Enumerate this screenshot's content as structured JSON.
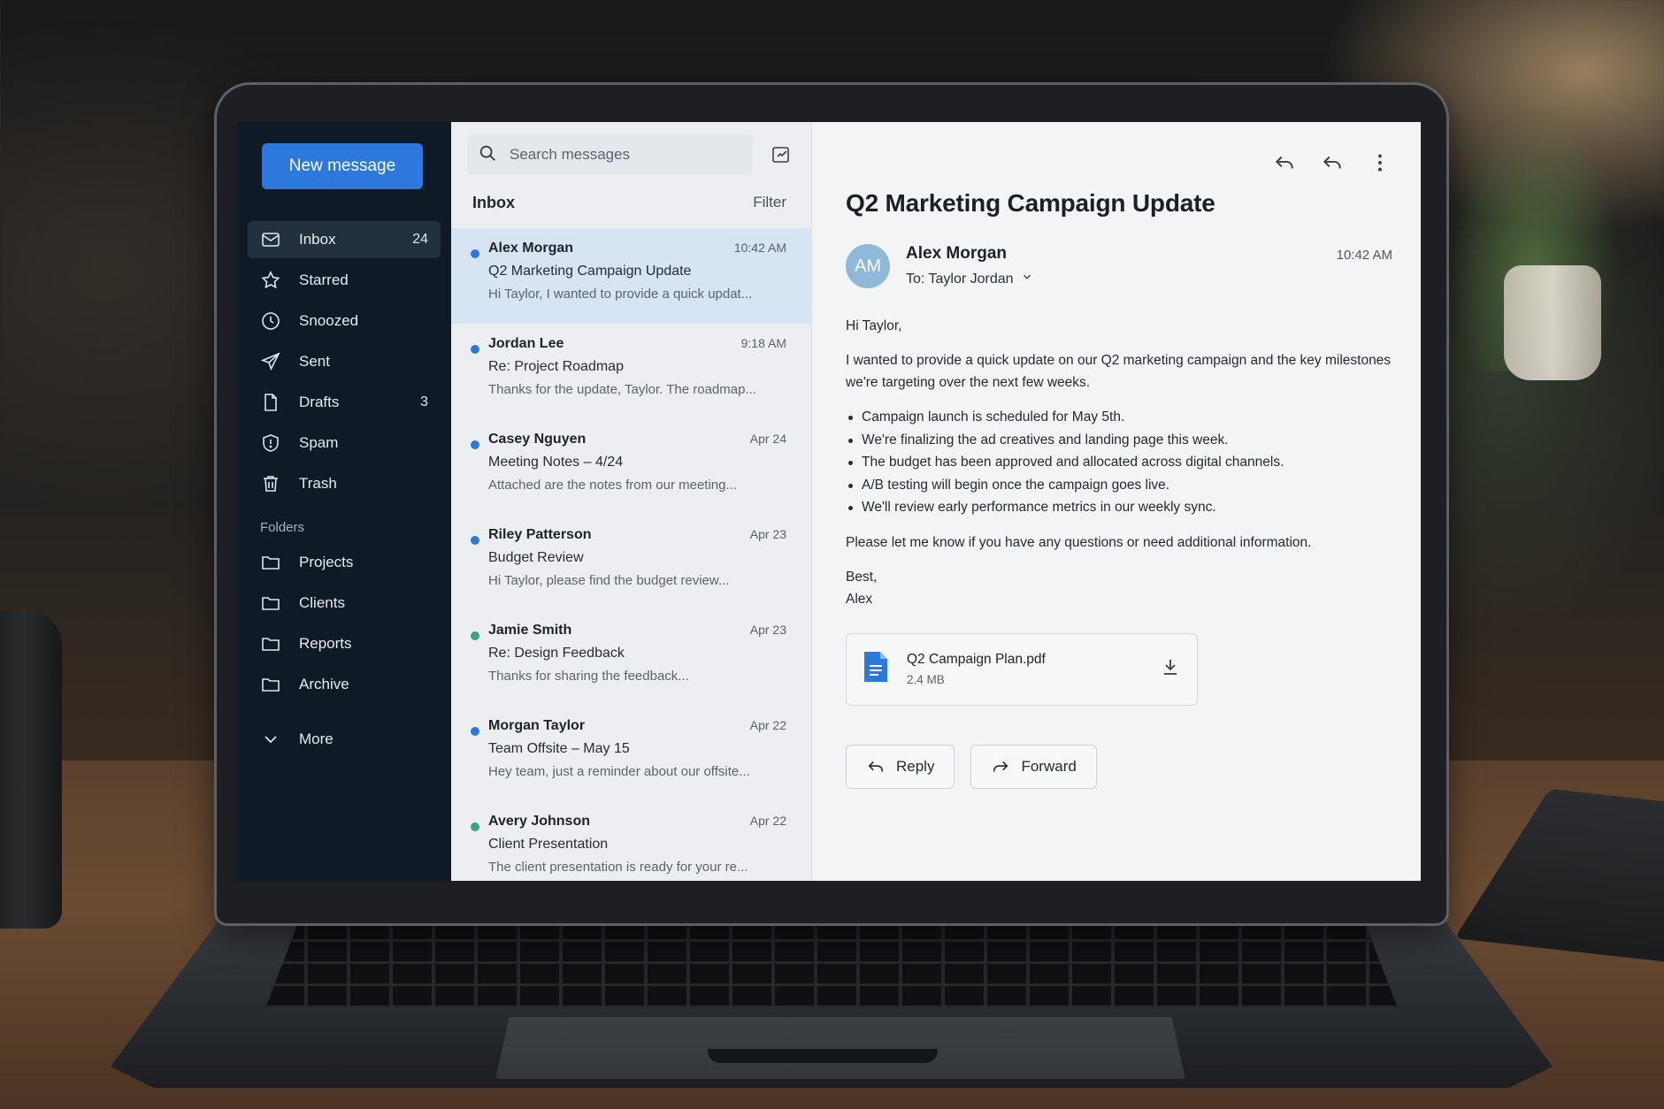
{
  "app": {
    "new_message_label": "New message"
  },
  "sidebar": {
    "items": [
      {
        "label": "Inbox",
        "count": "24",
        "icon": "mail-icon",
        "active": true
      },
      {
        "label": "Starred",
        "count": "",
        "icon": "star-icon"
      },
      {
        "label": "Snoozed",
        "count": "",
        "icon": "clock-icon"
      },
      {
        "label": "Sent",
        "count": "",
        "icon": "send-icon"
      },
      {
        "label": "Drafts",
        "count": "3",
        "icon": "draft-icon"
      },
      {
        "label": "Spam",
        "count": "",
        "icon": "spam-icon"
      },
      {
        "label": "Trash",
        "count": "",
        "icon": "trash-icon"
      }
    ],
    "folders_title": "Folders",
    "folders": [
      {
        "label": "Projects",
        "icon": "folder-icon"
      },
      {
        "label": "Clients",
        "icon": "folder-icon"
      },
      {
        "label": "Reports",
        "icon": "folder-icon"
      },
      {
        "label": "Archive",
        "icon": "folder-icon"
      }
    ],
    "more_label": "More"
  },
  "search": {
    "placeholder": "Search messages"
  },
  "list": {
    "title": "Inbox",
    "filter_label": "Filter",
    "messages": [
      {
        "sender": "Alex Morgan",
        "time": "10:42 AM",
        "subject": "Q2 Marketing Campaign Update",
        "preview": "Hi Taylor, I wanted to provide a quick updat...",
        "dot_color": "#2d78dc",
        "selected": true
      },
      {
        "sender": "Jordan Lee",
        "time": "9:18 AM",
        "subject": "Re: Project Roadmap",
        "preview": "Thanks for the update, Taylor. The roadmap...",
        "dot_color": "#2d78dc"
      },
      {
        "sender": "Casey Nguyen",
        "time": "Apr 24",
        "subject": "Meeting Notes – 4/24",
        "preview": "Attached are the notes from our meeting...",
        "dot_color": "#2d78dc"
      },
      {
        "sender": "Riley Patterson",
        "time": "Apr 23",
        "subject": "Budget Review",
        "preview": "Hi Taylor, please find the budget review...",
        "dot_color": "#2d78dc"
      },
      {
        "sender": "Jamie Smith",
        "time": "Apr 23",
        "subject": "Re: Design Feedback",
        "preview": "Thanks for sharing the feedback...",
        "dot_color": "#3aa383"
      },
      {
        "sender": "Morgan Taylor",
        "time": "Apr 22",
        "subject": "Team Offsite – May 15",
        "preview": "Hey team, just a reminder about our offsite...",
        "dot_color": "#2d78dc"
      },
      {
        "sender": "Avery Johnson",
        "time": "Apr 22",
        "subject": "Client Presentation",
        "preview": "The client presentation is ready for your re...",
        "dot_color": "#3aa383"
      }
    ]
  },
  "email": {
    "subject": "Q2 Marketing Campaign Update",
    "avatar_initials": "AM",
    "sender": "Alex Morgan",
    "to_line": "To: Taylor Jordan",
    "time": "10:42 AM",
    "greeting": "Hi Taylor,",
    "intro": "I wanted to provide a quick update on our Q2 marketing campaign and the key milestones we're targeting over the next few weeks.",
    "bullets": [
      "Campaign launch is scheduled for May 5th.",
      "We're finalizing the ad creatives and landing page this week.",
      "The budget has been approved and allocated across digital channels.",
      "A/B testing will begin once the campaign goes live.",
      "We'll review early performance metrics in our weekly sync."
    ],
    "closing": "Please let me know if you have any questions or need additional information.",
    "signoff": "Best,",
    "signature": "Alex",
    "attachment": {
      "name": "Q2 Campaign Plan.pdf",
      "size": "2.4 MB"
    },
    "reply_label": "Reply",
    "forward_label": "Forward"
  },
  "colors": {
    "accent": "#2d78dc",
    "sidebar_bg": "#0f1a26",
    "selected_row": "#d6e4f3",
    "avatar": "#8fb9d9"
  }
}
